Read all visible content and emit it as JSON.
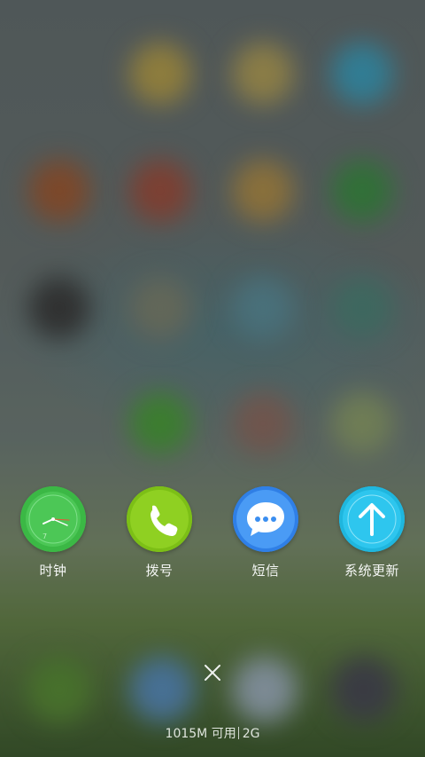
{
  "recent_apps": [
    {
      "label": "时钟",
      "icon": "clock-icon",
      "color": "#4cc34a"
    },
    {
      "label": "拨号",
      "icon": "phone-icon",
      "color": "#86c820"
    },
    {
      "label": "短信",
      "icon": "message-icon",
      "color": "#3a8ef0"
    },
    {
      "label": "系统更新",
      "icon": "update-arrow-icon",
      "color": "#2cc2e8"
    }
  ],
  "close_icon": "close-icon",
  "memory_status": {
    "available": "1015M 可用",
    "total": "2G"
  }
}
